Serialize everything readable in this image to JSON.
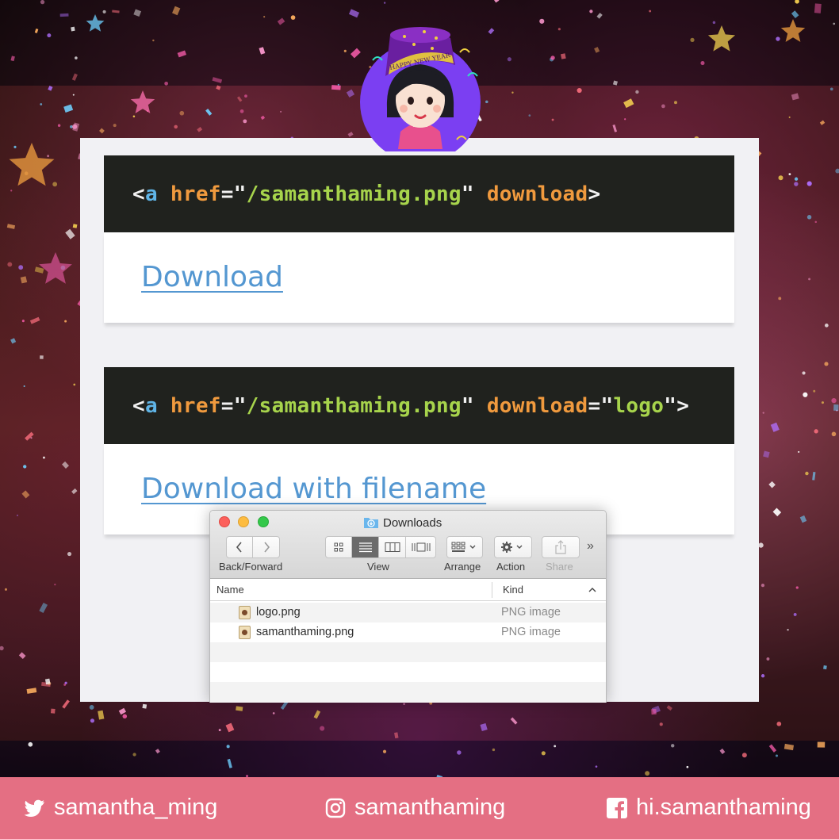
{
  "code_blocks": [
    {
      "tokens": [
        {
          "text": "<",
          "cls": "c-punct"
        },
        {
          "text": "a",
          "cls": "c-tag"
        },
        {
          "text": " ",
          "cls": "c-punct"
        },
        {
          "text": "href",
          "cls": "c-attr"
        },
        {
          "text": "=",
          "cls": "c-punct"
        },
        {
          "text": "\"",
          "cls": "c-punct"
        },
        {
          "text": "/samanthaming.png",
          "cls": "c-str"
        },
        {
          "text": "\"",
          "cls": "c-punct"
        },
        {
          "text": " ",
          "cls": "c-punct"
        },
        {
          "text": "download",
          "cls": "c-attr"
        },
        {
          "text": ">",
          "cls": "c-punct"
        }
      ]
    },
    {
      "tokens": [
        {
          "text": "<",
          "cls": "c-punct"
        },
        {
          "text": "a",
          "cls": "c-tag"
        },
        {
          "text": " ",
          "cls": "c-punct"
        },
        {
          "text": "href",
          "cls": "c-attr"
        },
        {
          "text": "=",
          "cls": "c-punct"
        },
        {
          "text": "\"",
          "cls": "c-punct"
        },
        {
          "text": "/samanthaming.png",
          "cls": "c-str"
        },
        {
          "text": "\"",
          "cls": "c-punct"
        },
        {
          "text": " ",
          "cls": "c-punct"
        },
        {
          "text": "download",
          "cls": "c-attr"
        },
        {
          "text": "=",
          "cls": "c-punct"
        },
        {
          "text": "\"",
          "cls": "c-punct"
        },
        {
          "text": "logo",
          "cls": "c-str"
        },
        {
          "text": "\"",
          "cls": "c-punct"
        },
        {
          "text": ">",
          "cls": "c-punct"
        }
      ]
    }
  ],
  "links": {
    "download": "Download",
    "download_with_filename": "Download with filename"
  },
  "finder": {
    "title": "Downloads",
    "toolbar": {
      "back_forward": "Back/Forward",
      "view": "View",
      "arrange": "Arrange",
      "action": "Action",
      "share": "Share"
    },
    "columns": {
      "name": "Name",
      "kind": "Kind"
    },
    "files": [
      {
        "name": "logo.png",
        "kind": "PNG image"
      },
      {
        "name": "samanthaming.png",
        "kind": "PNG image"
      }
    ]
  },
  "avatar": {
    "hat_text": "HAPPY NEW YEAR"
  },
  "footer": {
    "twitter": "samantha_ming",
    "instagram": "samanthaming",
    "facebook": "hi.samanthaming"
  },
  "colors": {
    "footer_bg": "#e46f83",
    "code_bg": "#20221e",
    "link": "#5497d1",
    "tag": "#5fb4e6",
    "attr": "#f09a3e",
    "string": "#a7d44c"
  }
}
